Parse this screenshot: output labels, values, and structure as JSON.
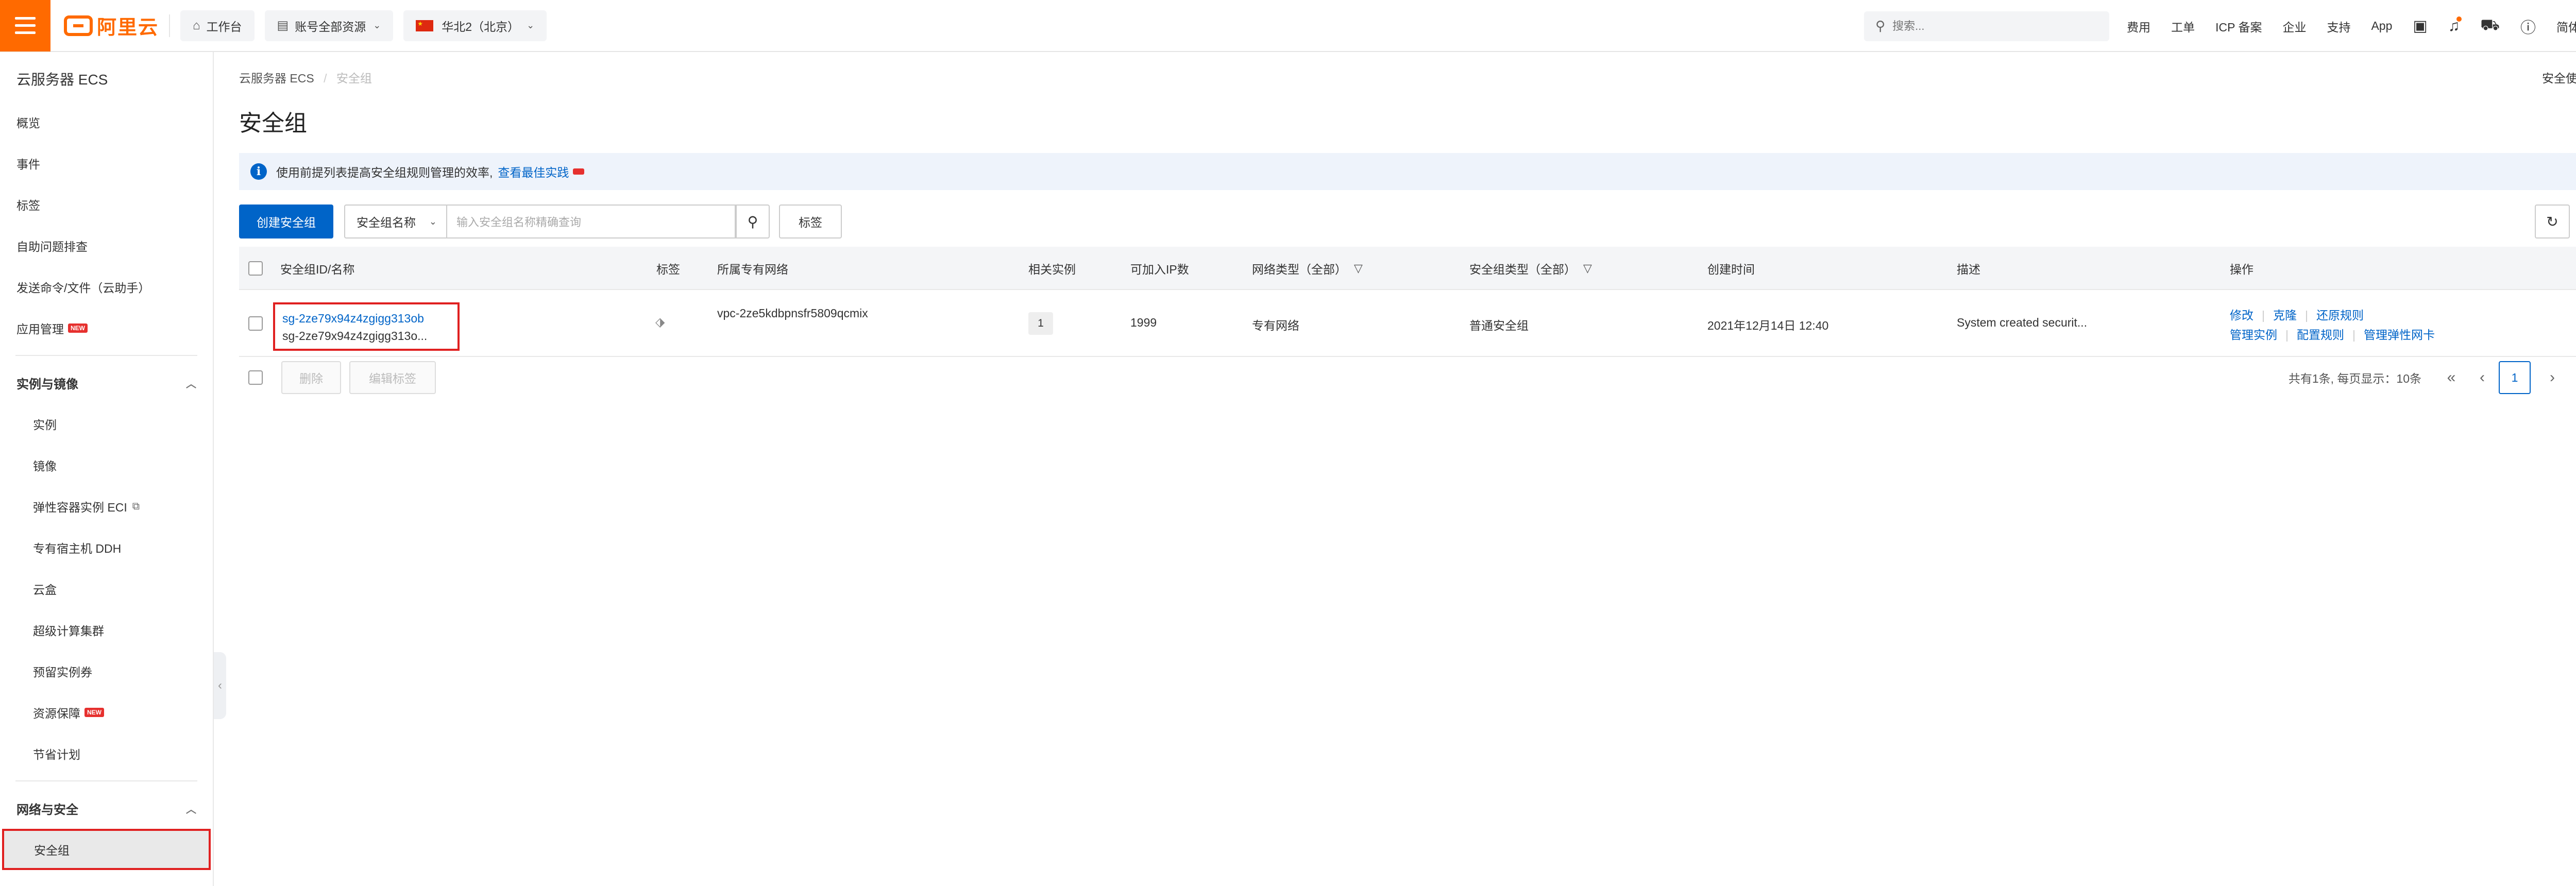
{
  "topbar": {
    "logo_text": "阿里云",
    "workbench_label": "工作台",
    "resources_label": "账号全部资源",
    "region_label": "华北2（北京）",
    "search_placeholder": "搜索...",
    "links": [
      "费用",
      "工单",
      "ICP 备案",
      "企业",
      "支持",
      "App"
    ],
    "lang_label": "简体"
  },
  "sidebar": {
    "title": "云服务器 ECS",
    "top_items": [
      "概览",
      "事件",
      "标签",
      "自助问题排查",
      "发送命令/文件（云助手）"
    ],
    "app_mgmt": {
      "label": "应用管理",
      "badge": "NEW"
    },
    "group1": "实例与镜像",
    "group1_items": {
      "instances": "实例",
      "images": "镜像",
      "eci": "弹性容器实例 ECI",
      "ddh": "专有宿主机 DDH",
      "cloudbox": "云盒",
      "scc": "超级计算集群",
      "reserved": "预留实例券",
      "guarantee": "资源保障",
      "guarantee_badge": "NEW",
      "savings": "节省计划"
    },
    "group2": "网络与安全",
    "active_item": "安全组"
  },
  "main": {
    "breadcrumb": {
      "root": "云服务器 ECS",
      "sep": "/",
      "current": "安全组"
    },
    "notice_link": "安全使用须知",
    "title": "安全组",
    "info": {
      "text": "使用前提列表提高安全组规则管理的效率,",
      "link": "查看最佳实践"
    },
    "toolbar": {
      "create_label": "创建安全组",
      "select_label": "安全组名称",
      "search_placeholder": "输入安全组名称精确查询",
      "tag_label": "标签"
    },
    "table": {
      "headers": {
        "id_name": "安全组ID/名称",
        "tag": "标签",
        "vpc": "所属专有网络",
        "related": "相关实例",
        "ip_count": "可加入IP数",
        "net_type": "网络类型（全部）",
        "sg_type": "安全组类型（全部）",
        "created": "创建时间",
        "desc": "描述",
        "ops": "操作"
      },
      "rows": [
        {
          "id": "sg-2ze79x94z4zgigg313ob",
          "name": "sg-2ze79x94z4zgigg313o...",
          "vpc": "vpc-2ze5kdbpnsfr5809qcmix",
          "related": "1",
          "ip_count": "1999",
          "net_type": "专有网络",
          "sg_type": "普通安全组",
          "created": "2021年12月14日 12:40",
          "desc": "System created securit...",
          "ops_row1": [
            "修改",
            "克隆",
            "还原规则"
          ],
          "ops_row2": [
            "管理实例",
            "配置规则",
            "管理弹性网卡"
          ]
        }
      ]
    },
    "footer": {
      "delete_label": "删除",
      "edit_tags_label": "编辑标签",
      "pager_text": "共有1条, 每页显示：10条",
      "current_page": "1"
    }
  }
}
